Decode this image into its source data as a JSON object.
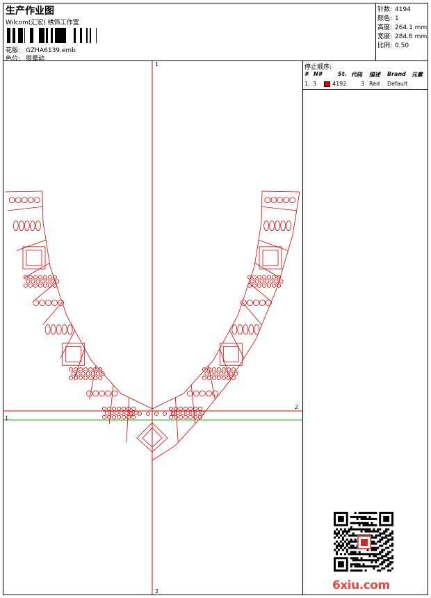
{
  "header": {
    "title": "生产作业图",
    "subtitle": "Wilcom(汇宏) 绣饰工作室",
    "design_label": "花版:",
    "design_file": "GZHA6139.emb",
    "position_label": "色位:",
    "position_value": "很晕动"
  },
  "specs": [
    {
      "label": "针数:",
      "value": "4194"
    },
    {
      "label": "颜色:",
      "value": "1"
    },
    {
      "label": "高度:",
      "value": "264.1 mm"
    },
    {
      "label": "宽度:",
      "value": "284.6 mm"
    },
    {
      "label": "比例:",
      "value": "0.50"
    }
  ],
  "stop_sequence": {
    "title": "停止顺序:",
    "columns": [
      "#",
      "N#",
      "St.",
      "代码",
      "描述",
      "Brand",
      "元素"
    ],
    "rows": [
      {
        "index": "1.",
        "needle": "3",
        "color": "#e00000",
        "stitches": "4192",
        "code": "3",
        "description": "Red",
        "brand": "Default",
        "element": ""
      }
    ]
  },
  "axes": {
    "top_label": "1",
    "bottom_label": "2",
    "left_label": "1",
    "right_label": "2"
  },
  "colors": {
    "design_stroke": "#e00000",
    "guide_green": "#00c000"
  },
  "watermark": "6xiu.com"
}
